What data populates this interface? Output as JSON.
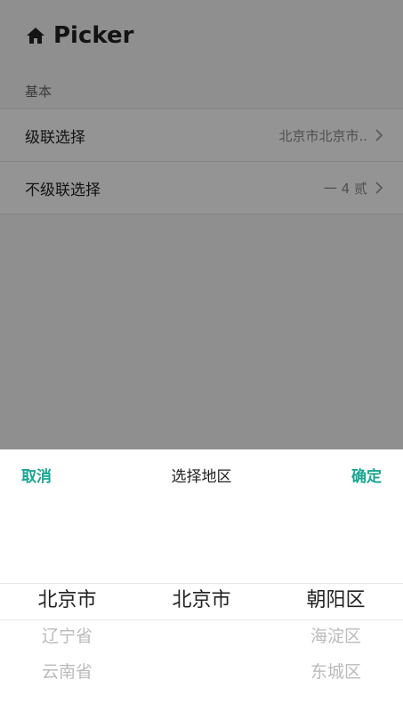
{
  "header": {
    "title": "Picker",
    "icon": "home-icon"
  },
  "section": {
    "label": "基本"
  },
  "list": {
    "items": [
      {
        "label": "级联选择",
        "value": "北京市北京市.."
      },
      {
        "label": "不级联选择",
        "value": "一 4 贰"
      }
    ]
  },
  "picker": {
    "cancel_label": "取消",
    "title": "选择地区",
    "confirm_label": "确定",
    "columns": [
      {
        "items": [
          "北京市",
          "辽宁省",
          "云南省"
        ]
      },
      {
        "items": [
          "北京市"
        ]
      },
      {
        "items": [
          "朝阳区",
          "海淀区",
          "东城区"
        ]
      }
    ]
  },
  "colors": {
    "accent": "#19a591",
    "mask": "rgba(0,0,0,0.42)"
  }
}
